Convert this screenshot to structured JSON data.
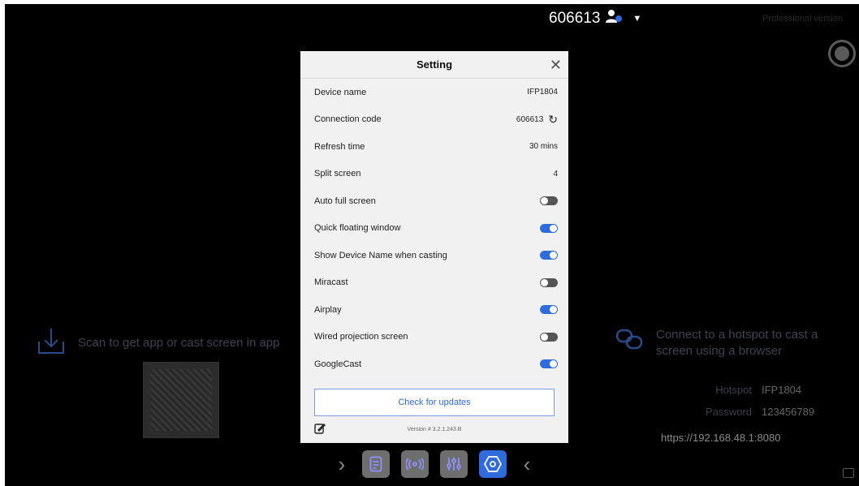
{
  "top": {
    "connection_code": "606613",
    "version_label": "Professional version"
  },
  "left": {
    "scan_text": "Scan to get app or cast screen in app"
  },
  "right": {
    "hotspot_text": "Connect to a hotspot to cast a screen using a browser",
    "hotspot_label": "Hotspot",
    "hotspot_value": "IFP1804",
    "password_label": "Password",
    "password_value": "123456789",
    "url": "https://192.168.48.1:8080"
  },
  "dialog": {
    "title": "Setting",
    "rows": [
      {
        "label": "Device name",
        "value": "IFP1804"
      },
      {
        "label": "Connection code",
        "value": "606613"
      },
      {
        "label": "Refresh time",
        "value": "30 mins"
      },
      {
        "label": "Split screen",
        "value": "4"
      },
      {
        "label": "Auto full screen",
        "toggle": false
      },
      {
        "label": "Quick floating window",
        "toggle": true
      },
      {
        "label": "Show Device Name when casting",
        "toggle": true
      },
      {
        "label": "Miracast",
        "toggle": false
      },
      {
        "label": "Airplay",
        "toggle": true
      },
      {
        "label": "Wired projection screen",
        "toggle": false
      },
      {
        "label": "GoogleCast",
        "toggle": true
      }
    ],
    "check_updates": "Check for updates",
    "version": "Version # 3.2.1.243.B"
  },
  "icons": {
    "user": "user-status-icon",
    "refresh": "refresh-icon",
    "feedback": "edit-feedback-icon"
  },
  "colors": {
    "accent": "#2f6bdc",
    "background": "#000000",
    "dialog_bg": "#f1f1f1"
  }
}
